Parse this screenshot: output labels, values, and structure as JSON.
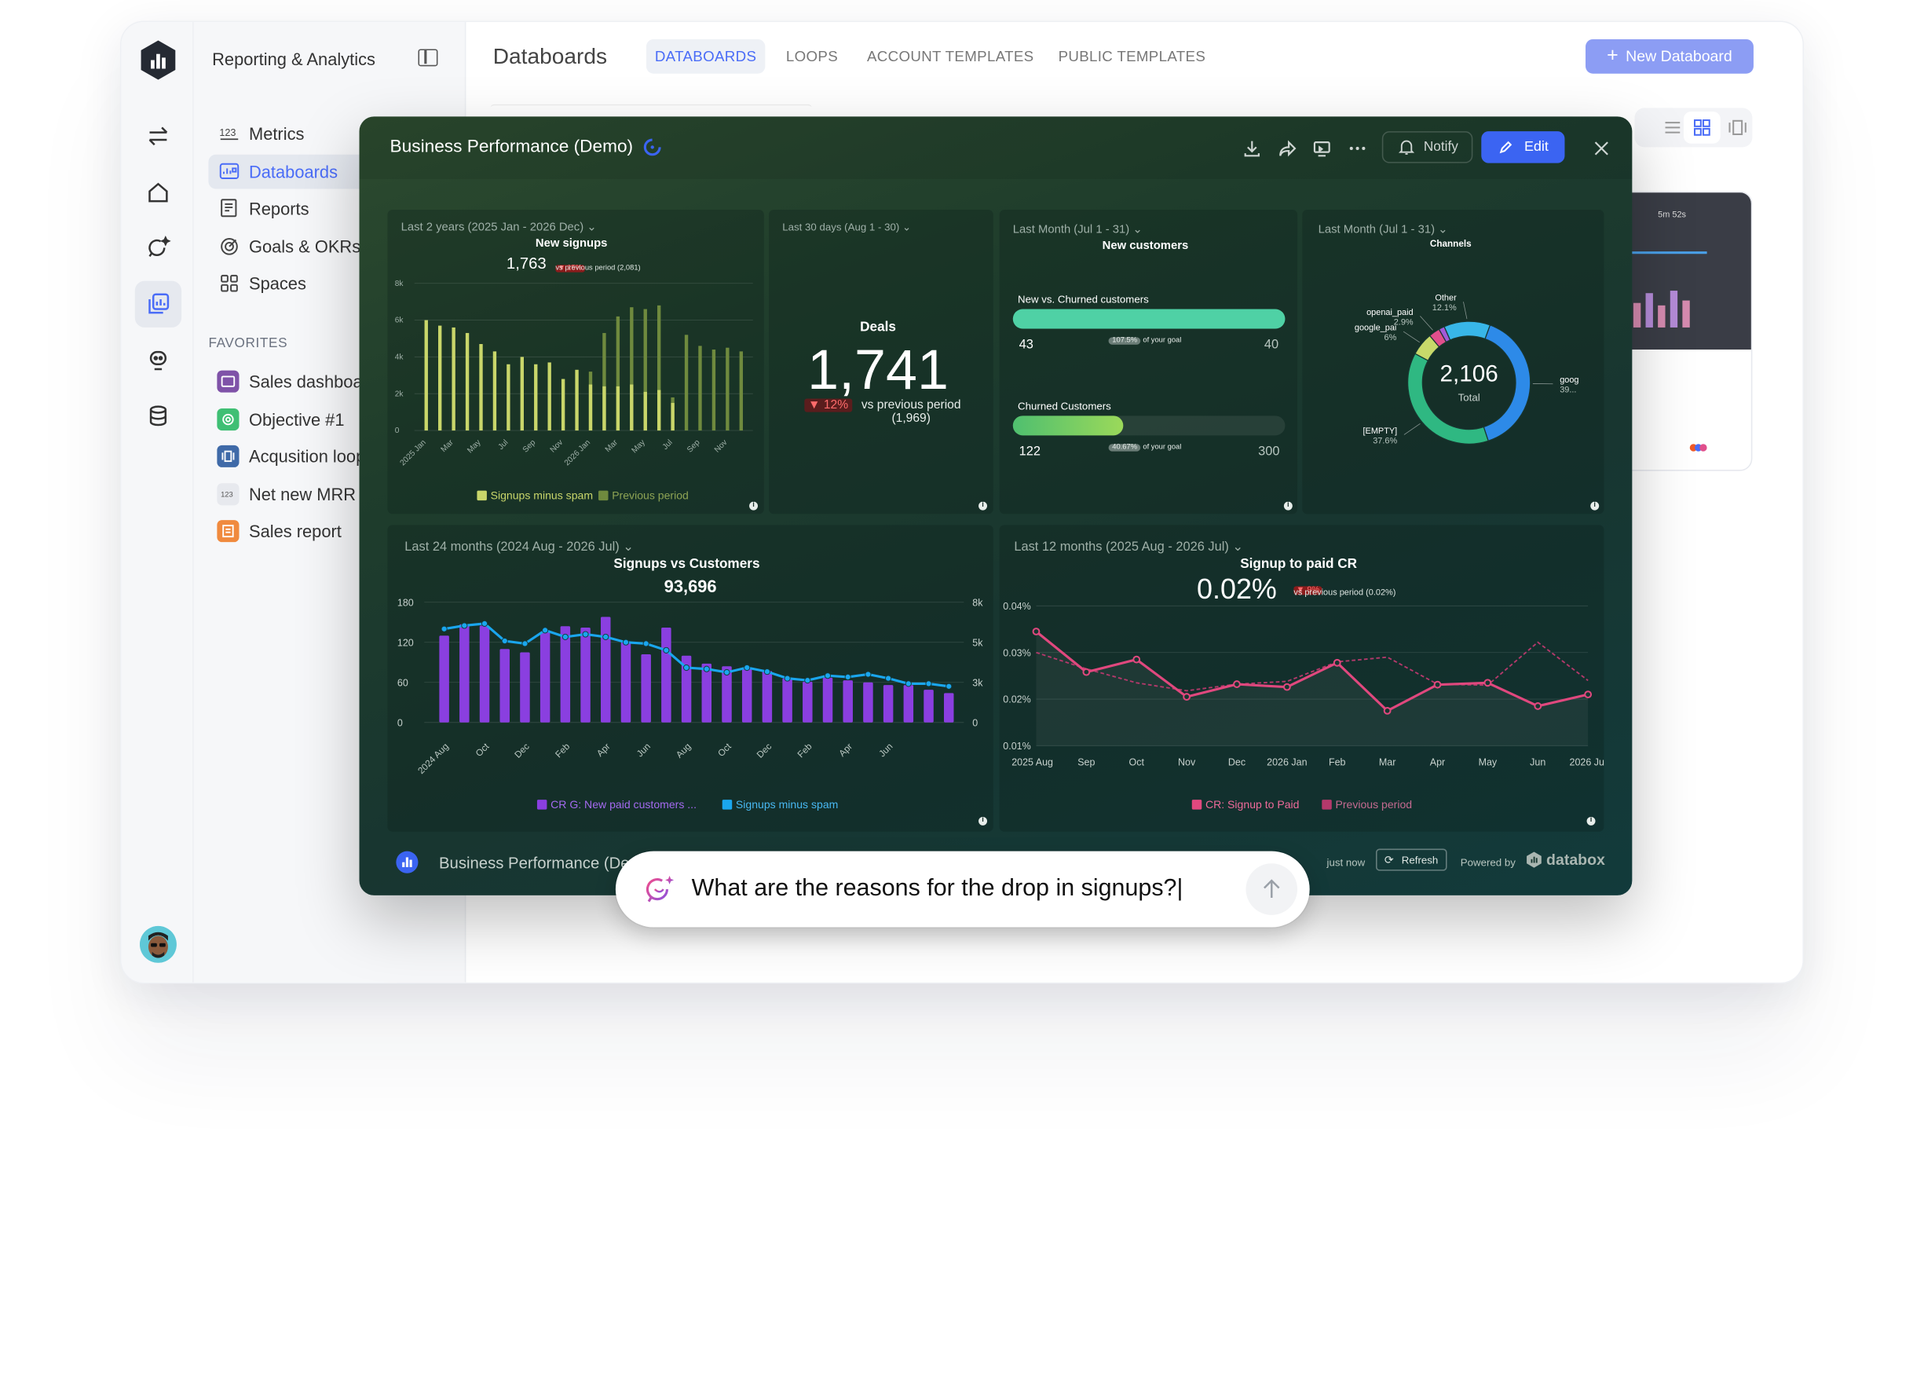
{
  "app": {
    "workspace": "Reporting & Analytics"
  },
  "sidebar": {
    "items": [
      {
        "label": "Metrics",
        "icon": "metrics-123-icon"
      },
      {
        "label": "Databoards",
        "icon": "databoard-icon",
        "active": true
      },
      {
        "label": "Reports",
        "icon": "report-icon"
      },
      {
        "label": "Goals & OKRs",
        "icon": "goal-target-icon"
      },
      {
        "label": "Spaces",
        "icon": "grid-spaces-icon"
      }
    ],
    "favorites_header": "FAVORITES",
    "favorites": [
      {
        "label": "Sales dashboard",
        "color": "#7f52a8"
      },
      {
        "label": "Objective #1",
        "color": "#3fbf74"
      },
      {
        "label": "Acqusition loop",
        "color": "#3f6aa8"
      },
      {
        "label": "Net new MRR",
        "color": "#e7e9ee"
      },
      {
        "label": "Sales report",
        "color": "#f08a3e"
      }
    ]
  },
  "header": {
    "title": "Databoards",
    "tabs": [
      "DATABOARDS",
      "LOOPS",
      "ACCOUNT TEMPLATES",
      "PUBLIC TEMPLATES"
    ],
    "new_button": "New Databoard"
  },
  "bg_card": {
    "time": "5m 52s"
  },
  "dashboard": {
    "title": "Business Performance (Demo)",
    "notify": "Notify",
    "edit": "Edit",
    "footer_name": "Business Performance (Demo)",
    "updated": "just now",
    "refresh": "Refresh",
    "powered": "Powered by",
    "brand": "databox",
    "accent": "#3b64f2"
  },
  "ask": {
    "question": "What are the reasons for the drop in signups?|"
  },
  "chart_data": [
    {
      "type": "bar",
      "period": "Last 2 years (2025 Jan - 2026 Dec)",
      "title": "New signups",
      "value": "1,763",
      "change": "▼ 15%",
      "comparison": "vs previous period (2,081)",
      "y_ticks": [
        "8k",
        "6k",
        "4k",
        "2k",
        "0"
      ],
      "ylim": [
        0,
        8000
      ],
      "categories": [
        "2025 Jan",
        "Mar",
        "May",
        "Jul",
        "Sep",
        "Nov",
        "2026 Jan",
        "Mar",
        "May",
        "Jul",
        "Sep",
        "Nov"
      ],
      "series": [
        {
          "name": "Signups minus spam",
          "color": "#c9d66a",
          "values": [
            6000,
            5700,
            5600,
            5300,
            4700,
            4300,
            3600,
            4000,
            3600,
            3700,
            2800,
            3300,
            2500,
            2400,
            2400,
            2500,
            2100,
            2200,
            1500
          ]
        },
        {
          "name": "Previous period",
          "color": "#6f8a3e",
          "values": [
            null,
            null,
            null,
            null,
            null,
            null,
            null,
            null,
            null,
            null,
            null,
            null,
            3200,
            5300,
            6200,
            6700,
            6600,
            6800,
            1800,
            5200,
            4600,
            4400,
            4500,
            4300
          ]
        }
      ]
    },
    {
      "type": "table",
      "period": "Last 30 days (Aug 1 - 30)",
      "title": "Deals",
      "value": "1,741",
      "change": "▼ 12%",
      "comparison": "vs previous period (1,969)"
    },
    {
      "type": "bar",
      "period": "Last Month (Jul 1 - 31)",
      "title": "New customers",
      "rows": [
        {
          "label": "New vs. Churned customers",
          "value": "43",
          "pct": "107.5%",
          "goal_text": "of your goal",
          "goal": "40",
          "fill": 1.0,
          "color": "#4fd1a5"
        },
        {
          "label": "Churned Customers",
          "value": "122",
          "pct": "40.67%",
          "goal_text": "of your goal",
          "goal": "300",
          "fill": 0.4067,
          "color": "#7ccf5a"
        }
      ]
    },
    {
      "type": "pie",
      "period": "Last Month (Jul 1 - 31)",
      "title": "Channels",
      "total": "2,106",
      "total_label": "Total",
      "slices": [
        {
          "label": "goog",
          "pct": "39...",
          "value": 39,
          "color": "#2d8ae8"
        },
        {
          "label": "[EMPTY]",
          "pct": "37.6%",
          "value": 37.6,
          "color": "#2fb882"
        },
        {
          "label": "google_pai",
          "pct": "6%",
          "value": 6,
          "color": "#c8d96a"
        },
        {
          "label": "openai_paid",
          "pct": "2.9%",
          "value": 2.9,
          "color": "#e04f8c"
        },
        {
          "label": "",
          "pct": "",
          "value": 1.5,
          "color": "#a25ad8"
        },
        {
          "label": "Other",
          "pct": "12.1%",
          "value": 12.1,
          "color": "#38b6e8"
        }
      ]
    },
    {
      "type": "bar",
      "period": "Last 24 months (2024 Aug - 2026 Jul)",
      "title": "Signups vs Customers",
      "value": "93,696",
      "y_left_ticks": [
        "180",
        "120",
        "60",
        "0"
      ],
      "y_right_ticks": [
        "8k",
        "5k",
        "3k",
        "0"
      ],
      "ylim": [
        0,
        180
      ],
      "categories": [
        "2024 Aug",
        "Oct",
        "Dec",
        "Feb",
        "Apr",
        "Jun",
        "Aug",
        "Oct",
        "Dec",
        "Feb",
        "Apr",
        "Jun"
      ],
      "series": [
        {
          "name": "CR G: New paid customers ...",
          "color": "#8a3fe0",
          "values": [
            130,
            147,
            145,
            110,
            105,
            135,
            144,
            142,
            158,
            120,
            102,
            142,
            100,
            88,
            84,
            82,
            77,
            66,
            61,
            67,
            63,
            60,
            56,
            56,
            49,
            44
          ]
        },
        {
          "name": "Signups minus spam",
          "color": "#1aa6ee",
          "values": [
            140,
            145,
            148,
            122,
            118,
            138,
            128,
            132,
            128,
            120,
            118,
            108,
            82,
            80,
            75,
            82,
            76,
            66,
            63,
            70,
            68,
            72,
            66,
            58,
            58,
            54
          ]
        }
      ]
    },
    {
      "type": "line",
      "period": "Last 12 months (2025 Aug - 2026 Jul)",
      "title": "Signup to paid CR",
      "value": "0.02%",
      "change": "▼ 9%",
      "comparison": "vs previous period (0.02%)",
      "y_ticks": [
        "0.04%",
        "0.03%",
        "0.02%",
        "0.01%"
      ],
      "ylim": [
        0.01,
        0.04
      ],
      "categories": [
        "2025 Aug",
        "Sep",
        "Oct",
        "Nov",
        "Dec",
        "2026 Jan",
        "Feb",
        "Mar",
        "Apr",
        "May",
        "Jun",
        "2026 Jul"
      ],
      "series": [
        {
          "name": "CR: Signup to Paid",
          "color": "#e0487e",
          "values": [
            0.0345,
            0.0258,
            0.0285,
            0.0205,
            0.0232,
            0.0226,
            0.0278,
            0.0175,
            0.0231,
            0.0235,
            0.0185,
            0.021
          ]
        },
        {
          "name": "Previous period",
          "color": "#b4396b",
          "values": [
            0.03,
            0.0265,
            0.0235,
            0.0218,
            0.0232,
            0.0238,
            0.028,
            0.029,
            0.0232,
            0.023,
            0.0322,
            0.024
          ]
        }
      ]
    }
  ]
}
